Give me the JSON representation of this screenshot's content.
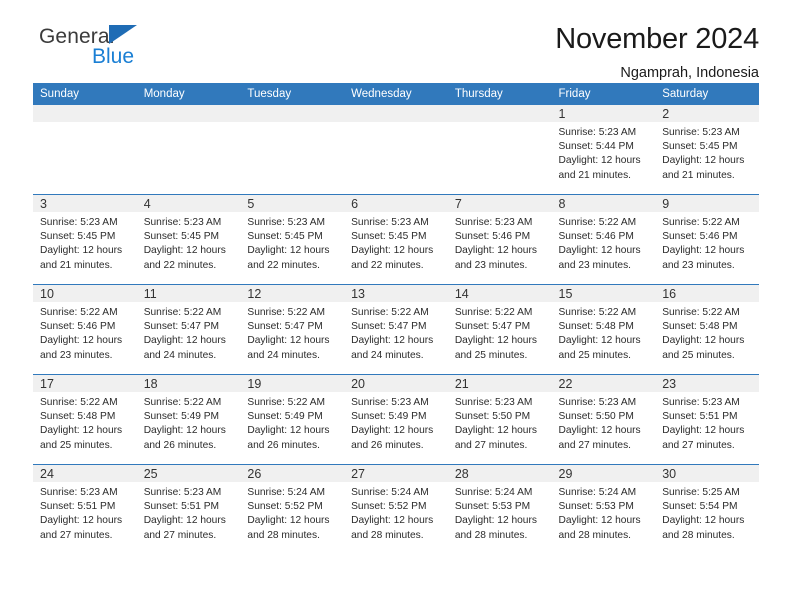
{
  "brand": {
    "name_top": "General",
    "name_bottom": "Blue",
    "triangle_color": "#1f6cb5",
    "blue_text_color": "#1a7fd4"
  },
  "header": {
    "title": "November 2024",
    "subtitle": "Ngamprah, Indonesia"
  },
  "theme": {
    "header_blue": "#3179bc",
    "daynum_band": "#f0f0f0",
    "page_background": "#ffffff"
  },
  "weekday_headers": [
    "Sunday",
    "Monday",
    "Tuesday",
    "Wednesday",
    "Thursday",
    "Friday",
    "Saturday"
  ],
  "labels": {
    "sunrise_prefix": "Sunrise:",
    "sunset_prefix": "Sunset:",
    "daylight_prefix": "Daylight:"
  },
  "weeks": [
    [
      {
        "day": "",
        "blank": true
      },
      {
        "day": "",
        "blank": true
      },
      {
        "day": "",
        "blank": true
      },
      {
        "day": "",
        "blank": true
      },
      {
        "day": "",
        "blank": true
      },
      {
        "day": "1",
        "sunrise": "Sunrise: 5:23 AM",
        "sunset": "Sunset: 5:44 PM",
        "daylight1": "Daylight: 12 hours",
        "daylight2": "and 21 minutes."
      },
      {
        "day": "2",
        "sunrise": "Sunrise: 5:23 AM",
        "sunset": "Sunset: 5:45 PM",
        "daylight1": "Daylight: 12 hours",
        "daylight2": "and 21 minutes."
      }
    ],
    [
      {
        "day": "3",
        "sunrise": "Sunrise: 5:23 AM",
        "sunset": "Sunset: 5:45 PM",
        "daylight1": "Daylight: 12 hours",
        "daylight2": "and 21 minutes."
      },
      {
        "day": "4",
        "sunrise": "Sunrise: 5:23 AM",
        "sunset": "Sunset: 5:45 PM",
        "daylight1": "Daylight: 12 hours",
        "daylight2": "and 22 minutes."
      },
      {
        "day": "5",
        "sunrise": "Sunrise: 5:23 AM",
        "sunset": "Sunset: 5:45 PM",
        "daylight1": "Daylight: 12 hours",
        "daylight2": "and 22 minutes."
      },
      {
        "day": "6",
        "sunrise": "Sunrise: 5:23 AM",
        "sunset": "Sunset: 5:45 PM",
        "daylight1": "Daylight: 12 hours",
        "daylight2": "and 22 minutes."
      },
      {
        "day": "7",
        "sunrise": "Sunrise: 5:23 AM",
        "sunset": "Sunset: 5:46 PM",
        "daylight1": "Daylight: 12 hours",
        "daylight2": "and 23 minutes."
      },
      {
        "day": "8",
        "sunrise": "Sunrise: 5:22 AM",
        "sunset": "Sunset: 5:46 PM",
        "daylight1": "Daylight: 12 hours",
        "daylight2": "and 23 minutes."
      },
      {
        "day": "9",
        "sunrise": "Sunrise: 5:22 AM",
        "sunset": "Sunset: 5:46 PM",
        "daylight1": "Daylight: 12 hours",
        "daylight2": "and 23 minutes."
      }
    ],
    [
      {
        "day": "10",
        "sunrise": "Sunrise: 5:22 AM",
        "sunset": "Sunset: 5:46 PM",
        "daylight1": "Daylight: 12 hours",
        "daylight2": "and 23 minutes."
      },
      {
        "day": "11",
        "sunrise": "Sunrise: 5:22 AM",
        "sunset": "Sunset: 5:47 PM",
        "daylight1": "Daylight: 12 hours",
        "daylight2": "and 24 minutes."
      },
      {
        "day": "12",
        "sunrise": "Sunrise: 5:22 AM",
        "sunset": "Sunset: 5:47 PM",
        "daylight1": "Daylight: 12 hours",
        "daylight2": "and 24 minutes."
      },
      {
        "day": "13",
        "sunrise": "Sunrise: 5:22 AM",
        "sunset": "Sunset: 5:47 PM",
        "daylight1": "Daylight: 12 hours",
        "daylight2": "and 24 minutes."
      },
      {
        "day": "14",
        "sunrise": "Sunrise: 5:22 AM",
        "sunset": "Sunset: 5:47 PM",
        "daylight1": "Daylight: 12 hours",
        "daylight2": "and 25 minutes."
      },
      {
        "day": "15",
        "sunrise": "Sunrise: 5:22 AM",
        "sunset": "Sunset: 5:48 PM",
        "daylight1": "Daylight: 12 hours",
        "daylight2": "and 25 minutes."
      },
      {
        "day": "16",
        "sunrise": "Sunrise: 5:22 AM",
        "sunset": "Sunset: 5:48 PM",
        "daylight1": "Daylight: 12 hours",
        "daylight2": "and 25 minutes."
      }
    ],
    [
      {
        "day": "17",
        "sunrise": "Sunrise: 5:22 AM",
        "sunset": "Sunset: 5:48 PM",
        "daylight1": "Daylight: 12 hours",
        "daylight2": "and 25 minutes."
      },
      {
        "day": "18",
        "sunrise": "Sunrise: 5:22 AM",
        "sunset": "Sunset: 5:49 PM",
        "daylight1": "Daylight: 12 hours",
        "daylight2": "and 26 minutes."
      },
      {
        "day": "19",
        "sunrise": "Sunrise: 5:22 AM",
        "sunset": "Sunset: 5:49 PM",
        "daylight1": "Daylight: 12 hours",
        "daylight2": "and 26 minutes."
      },
      {
        "day": "20",
        "sunrise": "Sunrise: 5:23 AM",
        "sunset": "Sunset: 5:49 PM",
        "daylight1": "Daylight: 12 hours",
        "daylight2": "and 26 minutes."
      },
      {
        "day": "21",
        "sunrise": "Sunrise: 5:23 AM",
        "sunset": "Sunset: 5:50 PM",
        "daylight1": "Daylight: 12 hours",
        "daylight2": "and 27 minutes."
      },
      {
        "day": "22",
        "sunrise": "Sunrise: 5:23 AM",
        "sunset": "Sunset: 5:50 PM",
        "daylight1": "Daylight: 12 hours",
        "daylight2": "and 27 minutes."
      },
      {
        "day": "23",
        "sunrise": "Sunrise: 5:23 AM",
        "sunset": "Sunset: 5:51 PM",
        "daylight1": "Daylight: 12 hours",
        "daylight2": "and 27 minutes."
      }
    ],
    [
      {
        "day": "24",
        "sunrise": "Sunrise: 5:23 AM",
        "sunset": "Sunset: 5:51 PM",
        "daylight1": "Daylight: 12 hours",
        "daylight2": "and 27 minutes."
      },
      {
        "day": "25",
        "sunrise": "Sunrise: 5:23 AM",
        "sunset": "Sunset: 5:51 PM",
        "daylight1": "Daylight: 12 hours",
        "daylight2": "and 27 minutes."
      },
      {
        "day": "26",
        "sunrise": "Sunrise: 5:24 AM",
        "sunset": "Sunset: 5:52 PM",
        "daylight1": "Daylight: 12 hours",
        "daylight2": "and 28 minutes."
      },
      {
        "day": "27",
        "sunrise": "Sunrise: 5:24 AM",
        "sunset": "Sunset: 5:52 PM",
        "daylight1": "Daylight: 12 hours",
        "daylight2": "and 28 minutes."
      },
      {
        "day": "28",
        "sunrise": "Sunrise: 5:24 AM",
        "sunset": "Sunset: 5:53 PM",
        "daylight1": "Daylight: 12 hours",
        "daylight2": "and 28 minutes."
      },
      {
        "day": "29",
        "sunrise": "Sunrise: 5:24 AM",
        "sunset": "Sunset: 5:53 PM",
        "daylight1": "Daylight: 12 hours",
        "daylight2": "and 28 minutes."
      },
      {
        "day": "30",
        "sunrise": "Sunrise: 5:25 AM",
        "sunset": "Sunset: 5:54 PM",
        "daylight1": "Daylight: 12 hours",
        "daylight2": "and 28 minutes."
      }
    ]
  ]
}
